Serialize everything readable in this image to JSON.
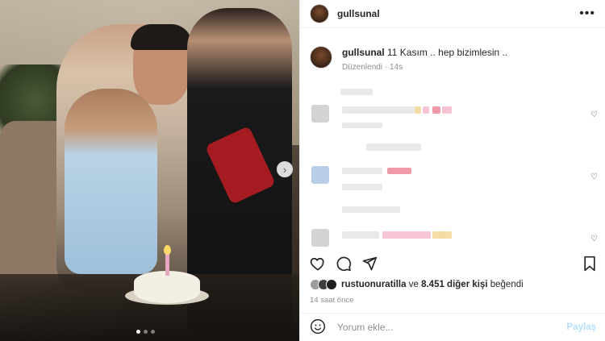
{
  "post": {
    "username": "gullsunal",
    "caption": "11 Kasım .. hep bizimlesin ..",
    "edited_label": "Düzenlendi",
    "edited_time": "14s",
    "carousel": {
      "total": 3,
      "current": 1
    }
  },
  "icons": {
    "more": "more-dots-icon",
    "next": "chevron-right-icon",
    "like": "heart-icon",
    "comment": "comment-icon",
    "share": "send-icon",
    "save": "bookmark-icon",
    "emoji": "smiley-icon"
  },
  "likes": {
    "user": "rustuonuratilla",
    "connector": "ve",
    "others": "8.451 diğer kişi",
    "suffix": "beğendi"
  },
  "time_ago": "14 saat önce",
  "comment_box": {
    "placeholder": "Yorum ekle...",
    "post_label": "Paylaş"
  },
  "colors": {
    "accent": "#0095f6",
    "post_disabled": "#b2dffc",
    "muted": "#8e8e8e",
    "text": "#262626"
  }
}
